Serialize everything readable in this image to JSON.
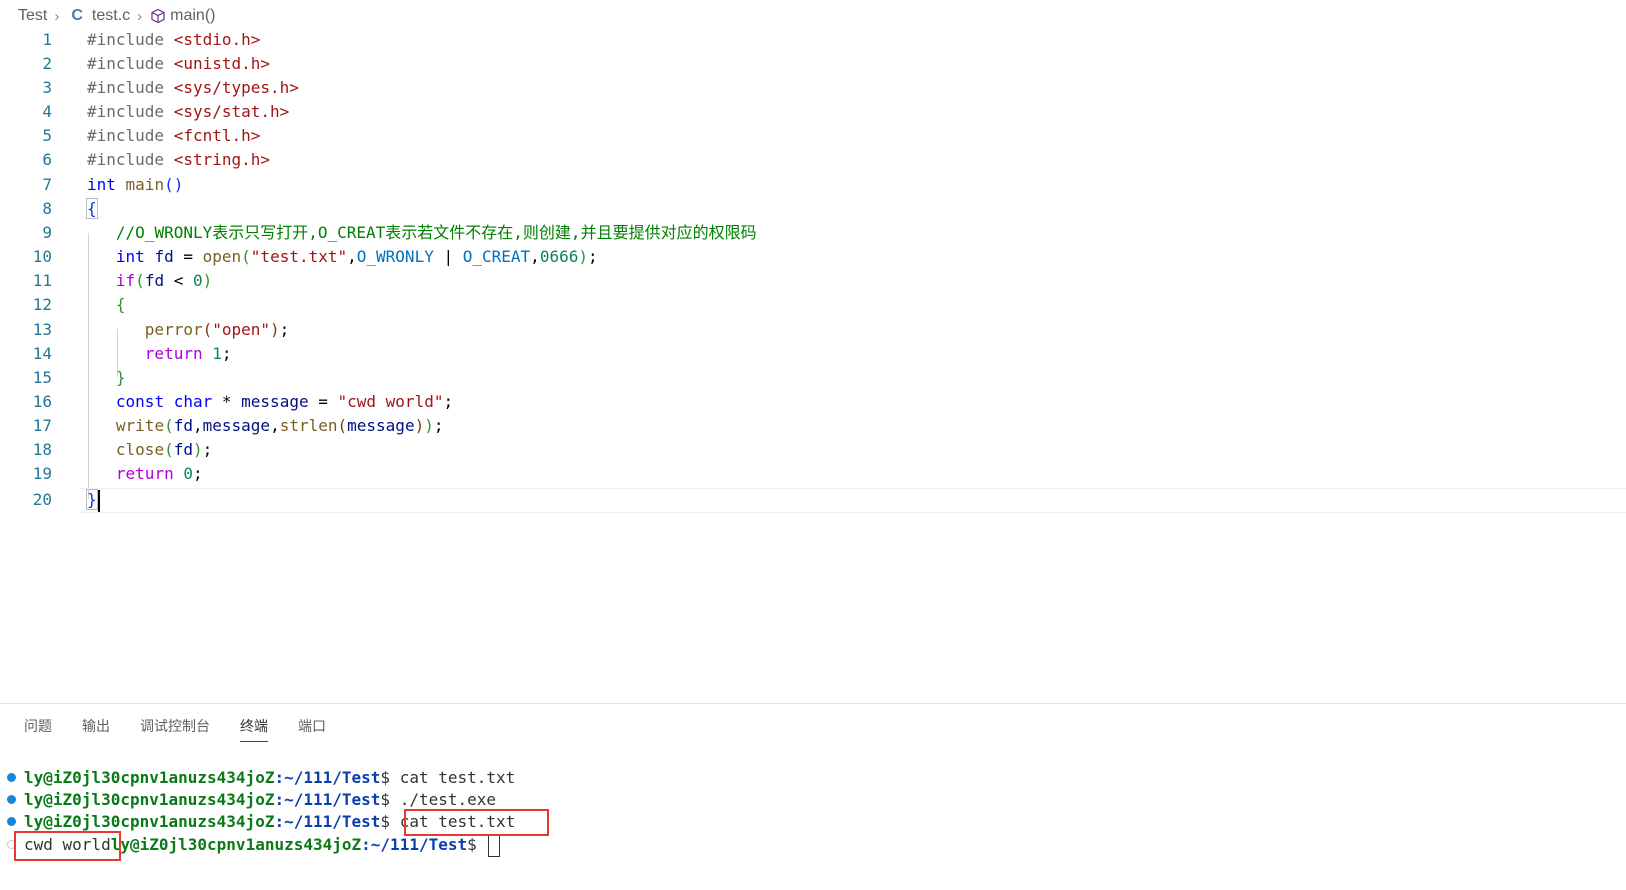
{
  "breadcrumb": {
    "folder": "Test",
    "file": "test.c",
    "symbol": "main()"
  },
  "code_lines": [
    {
      "n": "1",
      "text": "#include <stdio.h>"
    },
    {
      "n": "2",
      "text": "#include <unistd.h>"
    },
    {
      "n": "3",
      "text": "#include <sys/types.h>"
    },
    {
      "n": "4",
      "text": "#include <sys/stat.h>"
    },
    {
      "n": "5",
      "text": "#include <fcntl.h>"
    },
    {
      "n": "6",
      "text": "#include <string.h>"
    },
    {
      "n": "7",
      "text": "int main()"
    },
    {
      "n": "8",
      "text": "{"
    },
    {
      "n": "9",
      "text": "  //O_WRONLY表示只写打开,O_CREAT表示若文件不存在,则创建,并且要提供对应的权限码"
    },
    {
      "n": "10",
      "text": "  int fd = open(\"test.txt\",O_WRONLY | O_CREAT,0666);"
    },
    {
      "n": "11",
      "text": "  if(fd < 0)"
    },
    {
      "n": "12",
      "text": "  {"
    },
    {
      "n": "13",
      "text": "    perror(\"open\");"
    },
    {
      "n": "14",
      "text": "    return 1;"
    },
    {
      "n": "15",
      "text": "  }"
    },
    {
      "n": "16",
      "text": "  const char * message = \"cwd world\";"
    },
    {
      "n": "17",
      "text": "  write(fd,message,strlen(message));"
    },
    {
      "n": "18",
      "text": "  close(fd);"
    },
    {
      "n": "19",
      "text": "  return 0;"
    },
    {
      "n": "20",
      "text": "}"
    }
  ],
  "panel": {
    "tabs": [
      "问题",
      "输出",
      "调试控制台",
      "终端",
      "端口"
    ],
    "active_tab": "终端"
  },
  "terminal": {
    "prompt_user": "ly@iZ0jl30cpnv1anuzs434joZ",
    "prompt_path": ":~/111/Test",
    "prompt_symbol": "$",
    "lines": [
      {
        "status": "success",
        "command": "cat test.txt"
      },
      {
        "status": "success",
        "command": "./test.exe"
      },
      {
        "status": "success",
        "command": "cat test.txt"
      }
    ],
    "output": "cwd world",
    "status_colors": {
      "success": "#1a85d6",
      "idle": "#c8c8c8"
    }
  }
}
